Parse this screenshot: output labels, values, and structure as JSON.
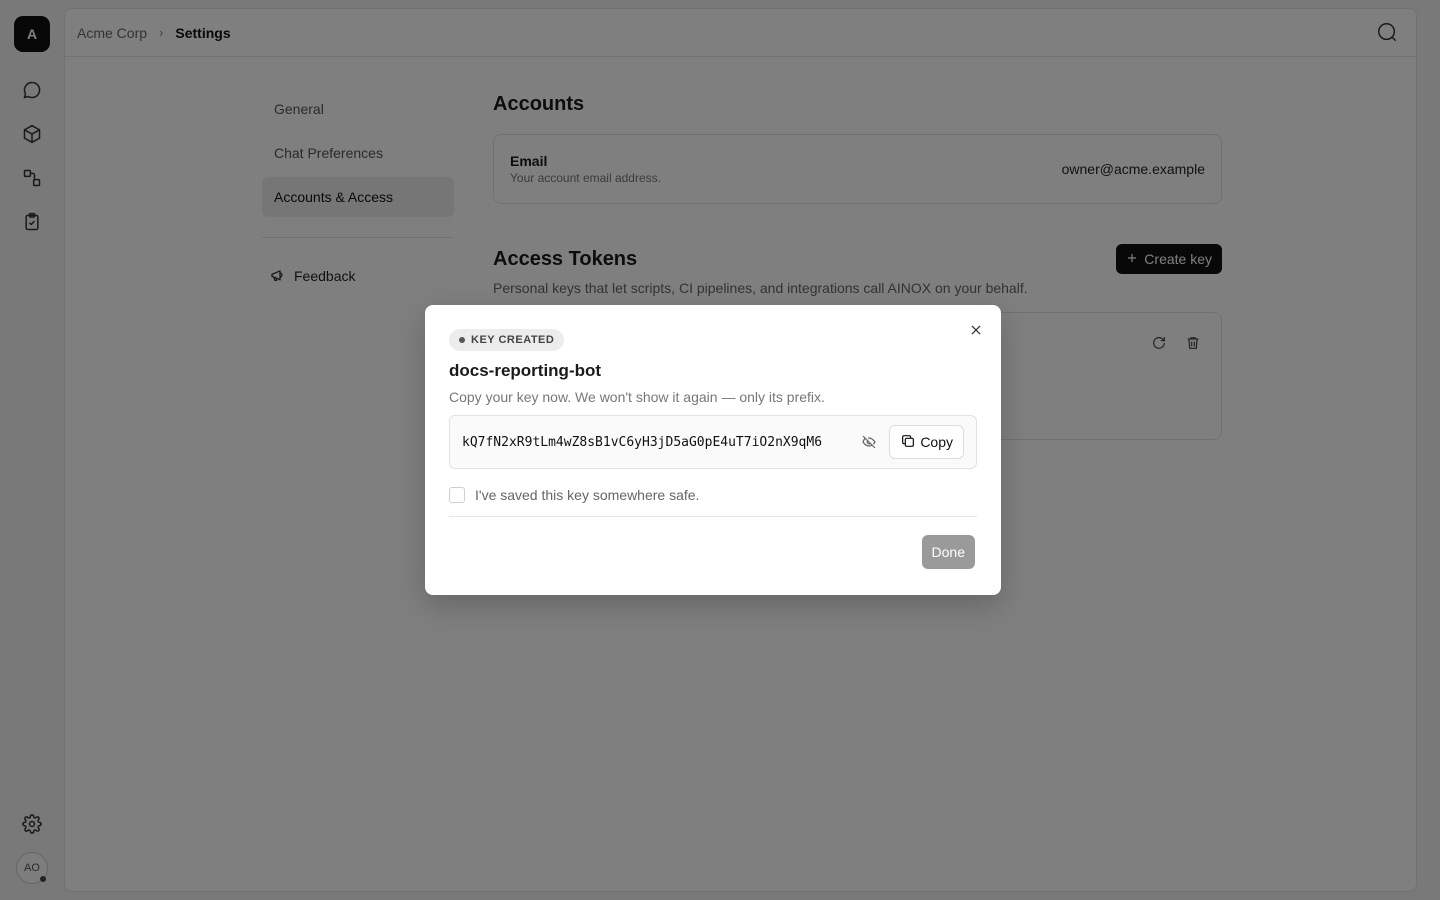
{
  "rail": {
    "logo_letter": "A",
    "avatar_initials": "AO"
  },
  "breadcrumb": {
    "org": "Acme Corp",
    "current": "Settings"
  },
  "settings_nav": {
    "items": [
      {
        "label": "General"
      },
      {
        "label": "Chat Preferences"
      },
      {
        "label": "Accounts & Access"
      }
    ],
    "feedback_label": "Feedback"
  },
  "accounts": {
    "heading": "Accounts",
    "email_label": "Email",
    "email_description": "Your account email address.",
    "email_value": "owner@acme.example"
  },
  "tokens": {
    "heading": "Access Tokens",
    "description": "Personal keys that let scripts, CI pipelines, and integrations call AINOX on your behalf.",
    "create_label": "Create key"
  },
  "modal": {
    "badge": "KEY CREATED",
    "title": "docs-reporting-bot",
    "subtitle": "Copy your key now. We won't show it again — only its prefix.",
    "key_value": "kQ7fN2xR9tLm4wZ8sB1vC6yH3jD5aG0pE4uT7iO2nX9qM6",
    "copy_label": "Copy",
    "checkbox_label": "I've saved this key somewhere safe.",
    "checkbox_checked": false,
    "done_label": "Done"
  }
}
